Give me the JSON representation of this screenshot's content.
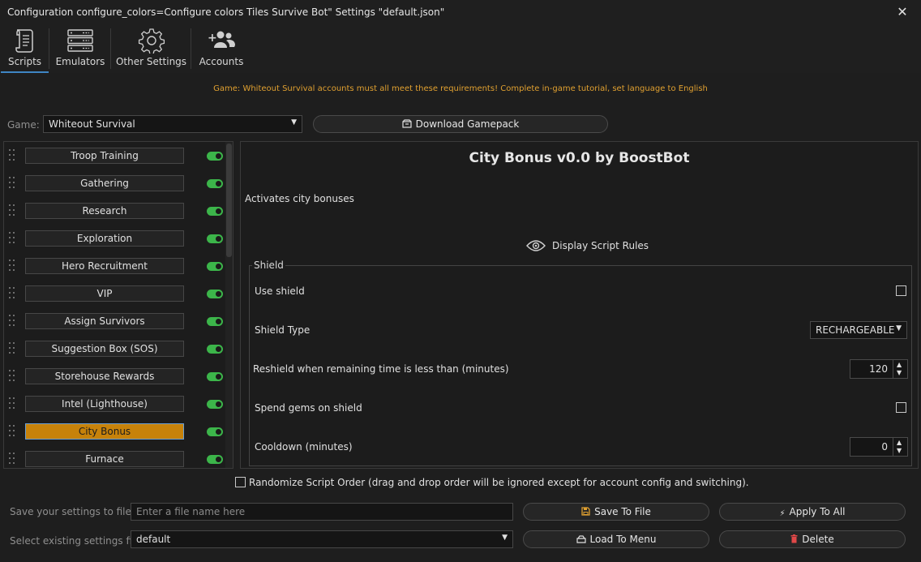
{
  "window": {
    "title": "Configuration configure_colors=Configure colors Tiles Survive Bot\" Settings \"default.json\"",
    "close_glyph": "✕"
  },
  "tabs": [
    {
      "label": "Scripts",
      "icon": "scroll-icon",
      "active": true
    },
    {
      "label": "Emulators",
      "icon": "server-icon",
      "active": false
    },
    {
      "label": "Other Settings",
      "icon": "gear-icon",
      "active": false
    },
    {
      "label": "Accounts",
      "icon": "add-user-icon",
      "active": false
    }
  ],
  "requirements": "Game: Whiteout Survival accounts must all meet these requirements! Complete in-game tutorial, set language to English",
  "game": {
    "label": "Game:",
    "selected": "Whiteout Survival",
    "download_label": "Download Gamepack"
  },
  "scripts": [
    {
      "label": "Troop Training",
      "enabled": true,
      "selected": false
    },
    {
      "label": "Gathering",
      "enabled": true,
      "selected": false
    },
    {
      "label": "Research",
      "enabled": true,
      "selected": false
    },
    {
      "label": "Exploration",
      "enabled": true,
      "selected": false
    },
    {
      "label": "Hero Recruitment",
      "enabled": true,
      "selected": false
    },
    {
      "label": "VIP",
      "enabled": true,
      "selected": false
    },
    {
      "label": "Assign Survivors",
      "enabled": true,
      "selected": false
    },
    {
      "label": "Suggestion Box (SOS)",
      "enabled": true,
      "selected": false
    },
    {
      "label": "Storehouse Rewards",
      "enabled": true,
      "selected": false
    },
    {
      "label": "Intel (Lighthouse)",
      "enabled": true,
      "selected": false
    },
    {
      "label": "City Bonus",
      "enabled": true,
      "selected": true
    },
    {
      "label": "Furnace",
      "enabled": true,
      "selected": false
    }
  ],
  "detail": {
    "title": "City Bonus v0.0 by BoostBot",
    "description": "Activates city bonuses",
    "rules_label": "Display Script Rules",
    "group_title": "Shield",
    "options": {
      "use_shield": {
        "label": "Use shield",
        "checked": false
      },
      "shield_type": {
        "label": "Shield Type",
        "value": "RECHARGEABLE"
      },
      "reshield": {
        "label": "Reshield when remaining time is less than (minutes)",
        "value": "120"
      },
      "spend_gems": {
        "label": "Spend gems on shield",
        "checked": false
      },
      "cooldown": {
        "label": "Cooldown (minutes)",
        "value": "0"
      }
    }
  },
  "randomize": {
    "label": "Randomize Script Order (drag and drop order will be ignored except for account config and switching).",
    "checked": false
  },
  "save": {
    "label": "Save your settings to file",
    "placeholder": "Enter a file name here",
    "save_button": "Save To File",
    "apply_button": "Apply To All"
  },
  "load": {
    "label": "Select existing settings file",
    "selected": "default",
    "load_button": "Load To Menu",
    "delete_button": "Delete"
  },
  "colors": {
    "accent": "#3f86c4",
    "selected_script": "#c7820a",
    "toggle_on": "#3cb54a",
    "warning_text": "#e0a030",
    "delete_icon": "#e04848",
    "save_icon": "#e0a030"
  }
}
